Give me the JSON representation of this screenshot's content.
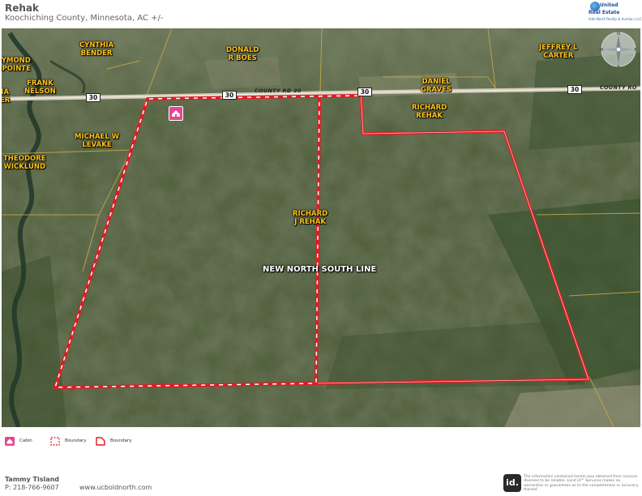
{
  "header": {
    "title": "Rehak",
    "subtitle": "Koochiching County, Minnesota,  AC +/-"
  },
  "brand": {
    "line1": "United",
    "line2": "Real Estate",
    "line3": "Side North Realty & Auction, LLC"
  },
  "map": {
    "owner_labels": [
      {
        "id": "raymond",
        "lines": [
          "AYMOND",
          "APOINTE"
        ]
      },
      {
        "id": "ia",
        "lines": [
          "IA",
          "ER"
        ]
      },
      {
        "id": "cynthia",
        "lines": [
          "CYNTHIA",
          "BENDER"
        ]
      },
      {
        "id": "donald",
        "lines": [
          "DONALD",
          "R BOES"
        ]
      },
      {
        "id": "jeffrey",
        "lines": [
          "JEFFREY L",
          "CARTER"
        ]
      },
      {
        "id": "frank",
        "lines": [
          "FRANK",
          "NELSON"
        ]
      },
      {
        "id": "daniel",
        "lines": [
          "DANIEL",
          "GRAVES"
        ]
      },
      {
        "id": "richard",
        "lines": [
          "RICHARD",
          "REHAK"
        ]
      },
      {
        "id": "michael",
        "lines": [
          "MICHAEL W",
          "LEVAKE"
        ]
      },
      {
        "id": "theodore",
        "lines": [
          "THEODORE",
          "WICKLUND"
        ]
      },
      {
        "id": "richardj",
        "lines": [
          "RICHARD",
          "J REHAK"
        ]
      }
    ],
    "annotation": "NEW NORTH SOUTH LINE",
    "road_name": "COUNTY RD 30",
    "road_name_right": "COUNTY RO",
    "route_shields": [
      "30",
      "30",
      "30",
      "30"
    ],
    "compass": {
      "n": "N",
      "s": "S",
      "e": "E",
      "w": "W"
    },
    "colors": {
      "boundary": "#e01b24",
      "dashed_boundary": "#ffffff",
      "label": "#ffc21a",
      "cabin": "#e8448f"
    }
  },
  "legend": [
    {
      "id": "cabin",
      "label": "Cabin",
      "icon": "cabin-icon"
    },
    {
      "id": "boundary-dashed",
      "label": "Boundary",
      "icon": "dashed-boundary-icon"
    },
    {
      "id": "boundary-solid",
      "label": "Boundary",
      "icon": "solid-boundary-icon"
    }
  ],
  "footer": {
    "agent_name": "Tammy Tisland",
    "agent_phone": "P: 218-766-9607",
    "website": "www.ucboldnorth.com",
    "id_logo": "id.",
    "disclaimer": "The information contained herein was obtained from sources deemed to be reliable. Land id™ Services makes no warranties or guarantees as to the completeness or accuracy thereof."
  }
}
